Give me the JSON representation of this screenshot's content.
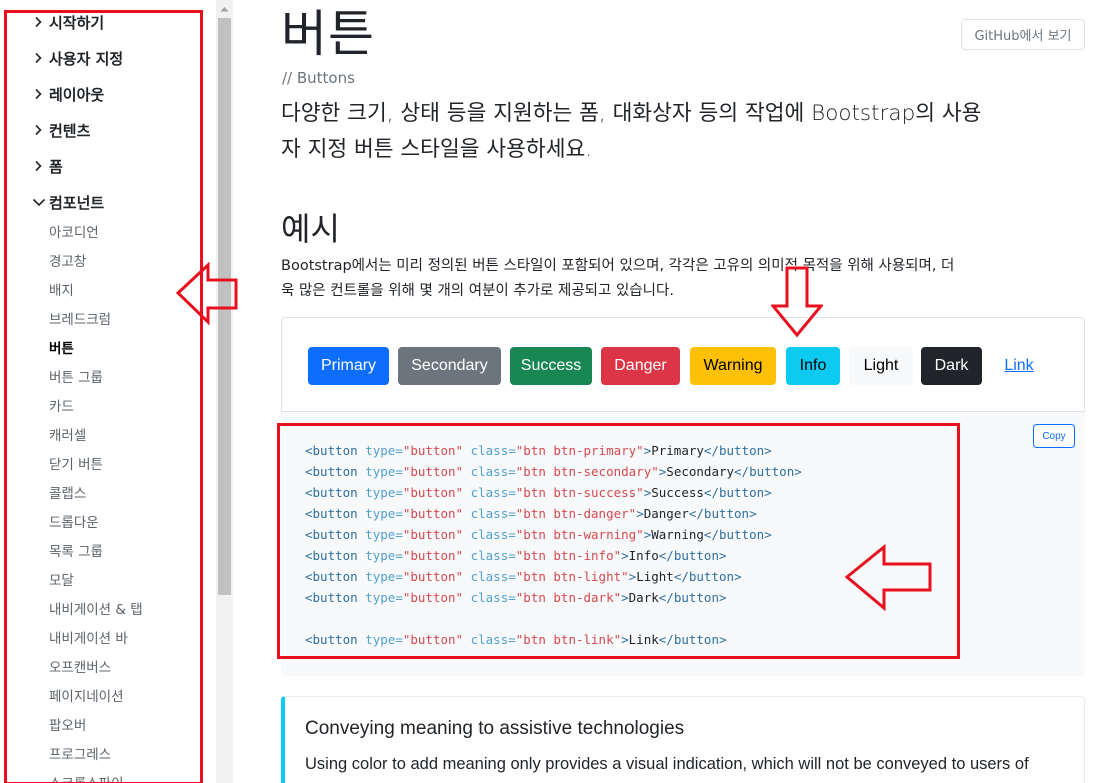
{
  "sidebar": {
    "groups": [
      {
        "label": "시작하기"
      },
      {
        "label": "사용자 지정"
      },
      {
        "label": "레이아웃"
      },
      {
        "label": "컨텐츠"
      },
      {
        "label": "폼"
      },
      {
        "label": "컴포넌트"
      }
    ],
    "items": [
      {
        "label": "아코디언"
      },
      {
        "label": "경고창"
      },
      {
        "label": "배지"
      },
      {
        "label": "브레드크럼"
      },
      {
        "label": "버튼",
        "active": true
      },
      {
        "label": "버튼 그룹"
      },
      {
        "label": "카드"
      },
      {
        "label": "캐러셀"
      },
      {
        "label": "닫기 버튼"
      },
      {
        "label": "콜랩스"
      },
      {
        "label": "드롭다운"
      },
      {
        "label": "목록 그룹"
      },
      {
        "label": "모달"
      },
      {
        "label": "내비게이션 & 탭"
      },
      {
        "label": "내비게이션 바"
      },
      {
        "label": "오프캔버스"
      },
      {
        "label": "페이지네이션"
      },
      {
        "label": "팝오버"
      },
      {
        "label": "프로그레스"
      },
      {
        "label": "스크롤스파이"
      }
    ]
  },
  "header": {
    "title": "버튼",
    "github_button": "GitHub에서 보기",
    "subtitle": "// Buttons"
  },
  "main": {
    "lead_line1": "다양한 크기, 상태 등을 지원하는 폼, 대화상자 등의 작업에 Bootstrap의 사용",
    "lead_line2": "자 지정 버튼 스타일을 사용하세요.",
    "section_title": "예시",
    "para_line1": "Bootstrap에서는 미리 정의된 버튼 스타일이 포함되어 있으며, 각각은 고유의 의미적 목적을 위해 사용되며, 더",
    "para_line2": "욱 많은 컨트롤을 위해 몇 개의 여분이 추가로 제공되고 있습니다."
  },
  "example_buttons": [
    {
      "label": "Primary",
      "bg": "#0d6efd",
      "fg": "#ffffff"
    },
    {
      "label": "Secondary",
      "bg": "#6c757d",
      "fg": "#ffffff"
    },
    {
      "label": "Success",
      "bg": "#198754",
      "fg": "#ffffff"
    },
    {
      "label": "Danger",
      "bg": "#dc3545",
      "fg": "#ffffff"
    },
    {
      "label": "Warning",
      "bg": "#ffc107",
      "fg": "#000000"
    },
    {
      "label": "Info",
      "bg": "#0dcaf0",
      "fg": "#000000"
    },
    {
      "label": "Light",
      "bg": "#f8f9fa",
      "fg": "#000000"
    },
    {
      "label": "Dark",
      "bg": "#212529",
      "fg": "#ffffff"
    },
    {
      "label": "Link",
      "bg": "transparent",
      "fg": "#0d6efd"
    }
  ],
  "code": {
    "copy_label": "Copy",
    "lines": [
      {
        "cls": "btn btn-primary",
        "text": "Primary"
      },
      {
        "cls": "btn btn-secondary",
        "text": "Secondary"
      },
      {
        "cls": "btn btn-success",
        "text": "Success"
      },
      {
        "cls": "btn btn-danger",
        "text": "Danger"
      },
      {
        "cls": "btn btn-warning",
        "text": "Warning"
      },
      {
        "cls": "btn btn-info",
        "text": "Info"
      },
      {
        "cls": "btn btn-light",
        "text": "Light"
      },
      {
        "cls": "btn btn-dark",
        "text": "Dark"
      },
      {
        "cls": "",
        "text": ""
      },
      {
        "cls": "btn btn-link",
        "text": "Link"
      }
    ]
  },
  "callout": {
    "title": "Conveying meaning to assistive technologies",
    "text": "Using color to add meaning only provides a visual indication, which will not be conveyed to users of"
  },
  "colors": {
    "annotation": "#e8101e",
    "callout_accent": "#0dcaf0"
  }
}
